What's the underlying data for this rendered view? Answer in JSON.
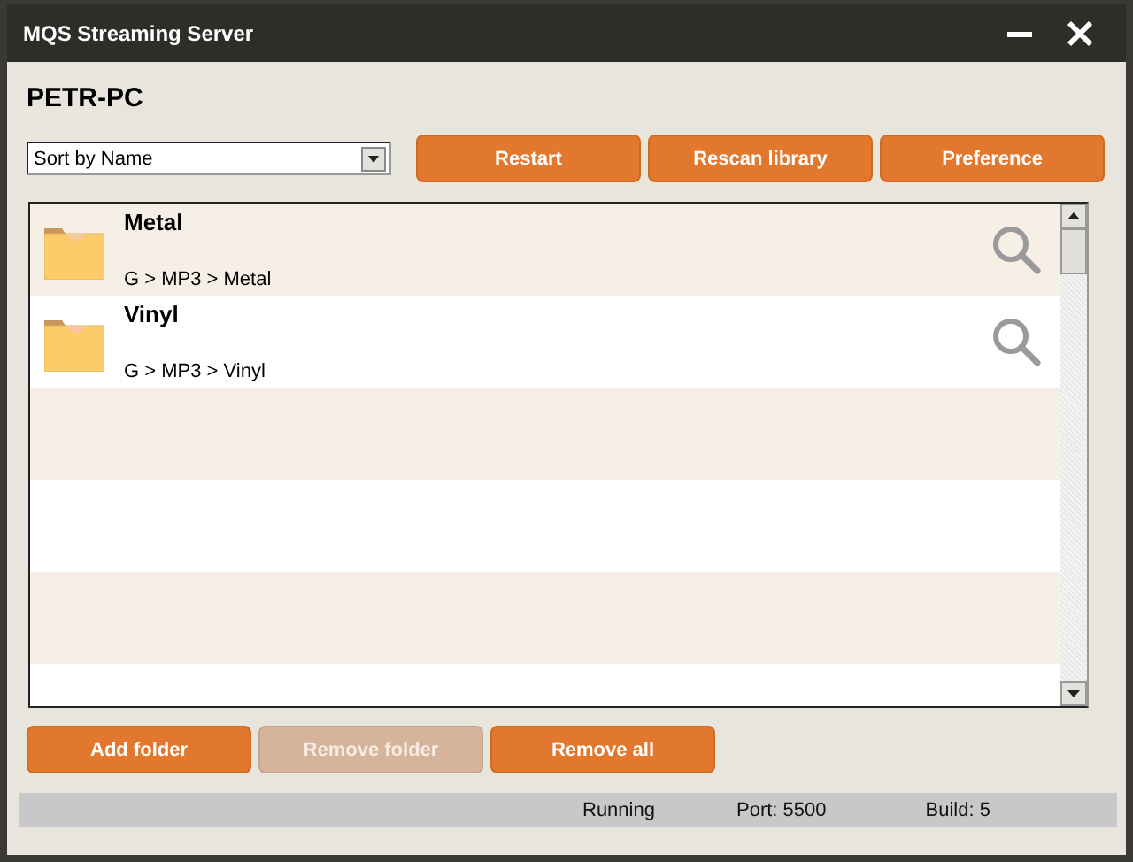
{
  "window": {
    "title": "MQS Streaming Server"
  },
  "host": "PETR-PC",
  "sort": {
    "value": "Sort by Name"
  },
  "top_buttons": [
    {
      "label": "Restart",
      "disabled": false
    },
    {
      "label": "Rescan library",
      "disabled": false
    },
    {
      "label": "Preference",
      "disabled": false
    }
  ],
  "folders": [
    {
      "name": "Metal",
      "path": "G > MP3 > Metal"
    },
    {
      "name": "Vinyl",
      "path": "G > MP3 > Vinyl"
    }
  ],
  "bottom_buttons": [
    {
      "label": "Add folder",
      "disabled": false
    },
    {
      "label": "Remove folder",
      "disabled": true
    },
    {
      "label": "Remove all",
      "disabled": false
    }
  ],
  "status_bar": {
    "state": "Running",
    "port": "Port: 5500",
    "build": "Build: 5"
  }
}
